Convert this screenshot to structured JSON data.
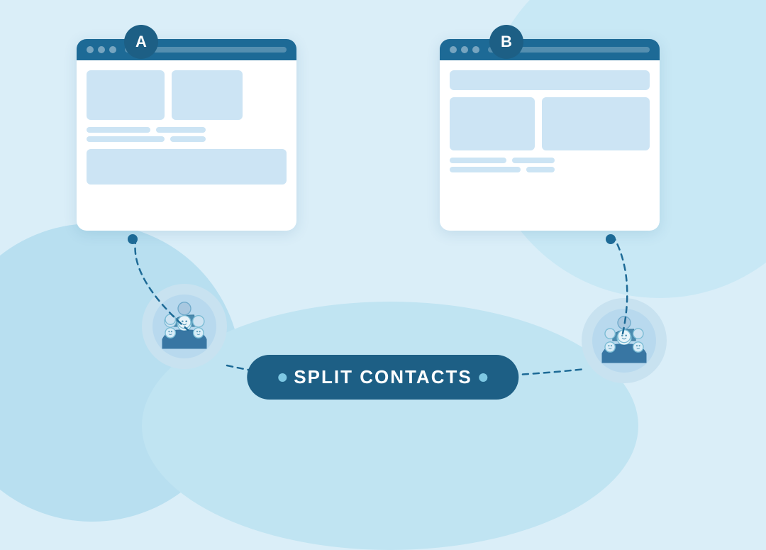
{
  "background": {
    "color": "#daeef8"
  },
  "card_a": {
    "badge": "A",
    "position": "left"
  },
  "card_b": {
    "badge": "B",
    "position": "right"
  },
  "split_contacts": {
    "label": "SPLIT CONTACTS",
    "pill_dot_color": "#7ec8e3",
    "pill_bg": "#1d5f85",
    "text_color": "#ffffff"
  },
  "people_groups": {
    "left_label": "group-left",
    "right_label": "group-right"
  }
}
